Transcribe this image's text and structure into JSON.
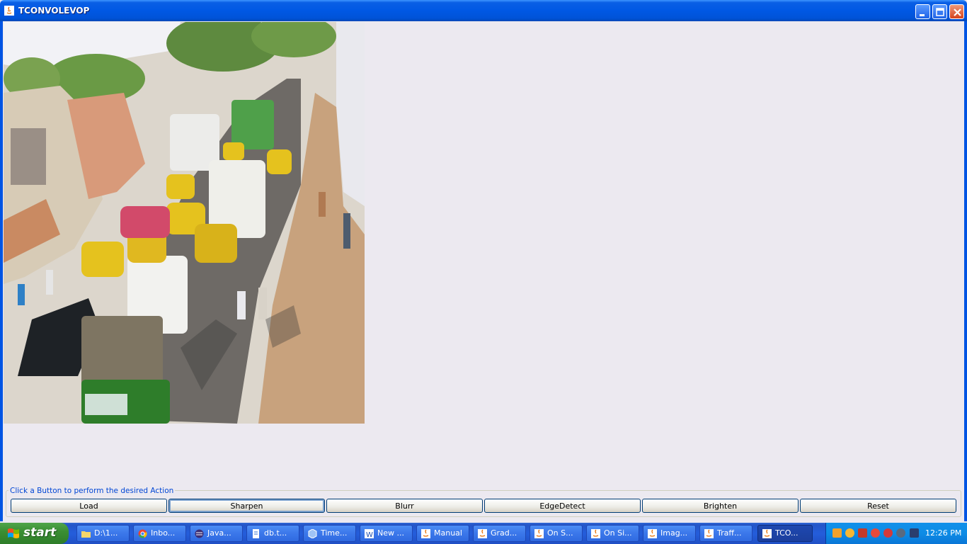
{
  "window": {
    "title": "TCONVOLEVOP"
  },
  "instruction": "Click a Button to perform the desired Action",
  "buttons": [
    {
      "label": "Load"
    },
    {
      "label": "Sharpen"
    },
    {
      "label": "Blurr"
    },
    {
      "label": "EdgeDetect"
    },
    {
      "label": "Brighten"
    },
    {
      "label": "Reset"
    }
  ],
  "taskbar": {
    "start_label": "start",
    "tasks": [
      {
        "label": "D:\\1...",
        "icon": "folder-icon"
      },
      {
        "label": "Inbo...",
        "icon": "chrome-icon"
      },
      {
        "label": "Java...",
        "icon": "eclipse-icon"
      },
      {
        "label": "db.t...",
        "icon": "document-icon"
      },
      {
        "label": "Time...",
        "icon": "cube-icon"
      },
      {
        "label": "New ...",
        "icon": "word-icon"
      },
      {
        "label": "Manual",
        "icon": "java-icon"
      },
      {
        "label": "Grad...",
        "icon": "java-icon"
      },
      {
        "label": "On S...",
        "icon": "java-icon"
      },
      {
        "label": "On Si...",
        "icon": "java-icon"
      },
      {
        "label": "Imag...",
        "icon": "java-icon"
      },
      {
        "label": "Traff...",
        "icon": "java-icon"
      },
      {
        "label": "TCO...",
        "icon": "java-icon"
      }
    ],
    "clock": "12:26 PM"
  },
  "colors": {
    "titlebar": "#0058E4",
    "taskbar": "#245DDB",
    "start": "#3B8F33",
    "window_bg": "#ECE9F0"
  }
}
